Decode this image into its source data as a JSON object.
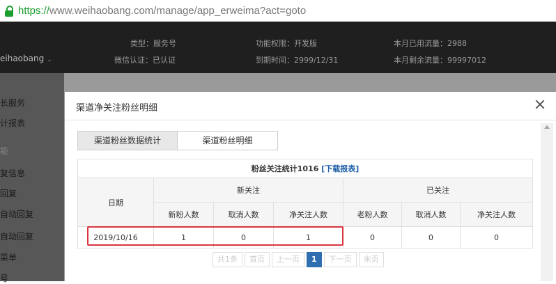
{
  "browser": {
    "url_scheme": "https://",
    "url_rest": "www.weihaobang.com/manage/app_erweima?act=goto"
  },
  "header": {
    "brand": "eihaobang",
    "type": "类型：服务号",
    "permission": "功能权限：开发版",
    "traffic_used": "本月已用流量：2988",
    "wechat_cert": "微信认证：已认证",
    "expire": "到期时间：2999/12/31",
    "traffic_left": "本月剩余流量：99997012"
  },
  "sidebar": {
    "items": [
      "长服务",
      "计报表",
      "能",
      "复信息",
      "回复",
      "自动回复",
      "自动回复",
      "菜单",
      "号"
    ]
  },
  "modal": {
    "title": "渠道净关注粉丝明细",
    "tabs": [
      "渠道粉丝数据统计",
      "渠道粉丝明细"
    ],
    "summary": "粉丝关注统计1016",
    "download": "[下载报表]",
    "col_date": "日期",
    "group_new": "新关注",
    "group_old": "已关注",
    "sub_headers": [
      "新粉人数",
      "取消人数",
      "净关注人数",
      "老粉人数",
      "取消人数",
      "净关注人数"
    ],
    "rows": [
      {
        "date": "2019/10/16",
        "values": [
          "1",
          "0",
          "1",
          "0",
          "0",
          "0"
        ]
      }
    ],
    "pager": {
      "total": "共1条",
      "first": "首页",
      "prev": "上一页",
      "current": "1",
      "next": "下一页",
      "last": "末页"
    }
  }
}
